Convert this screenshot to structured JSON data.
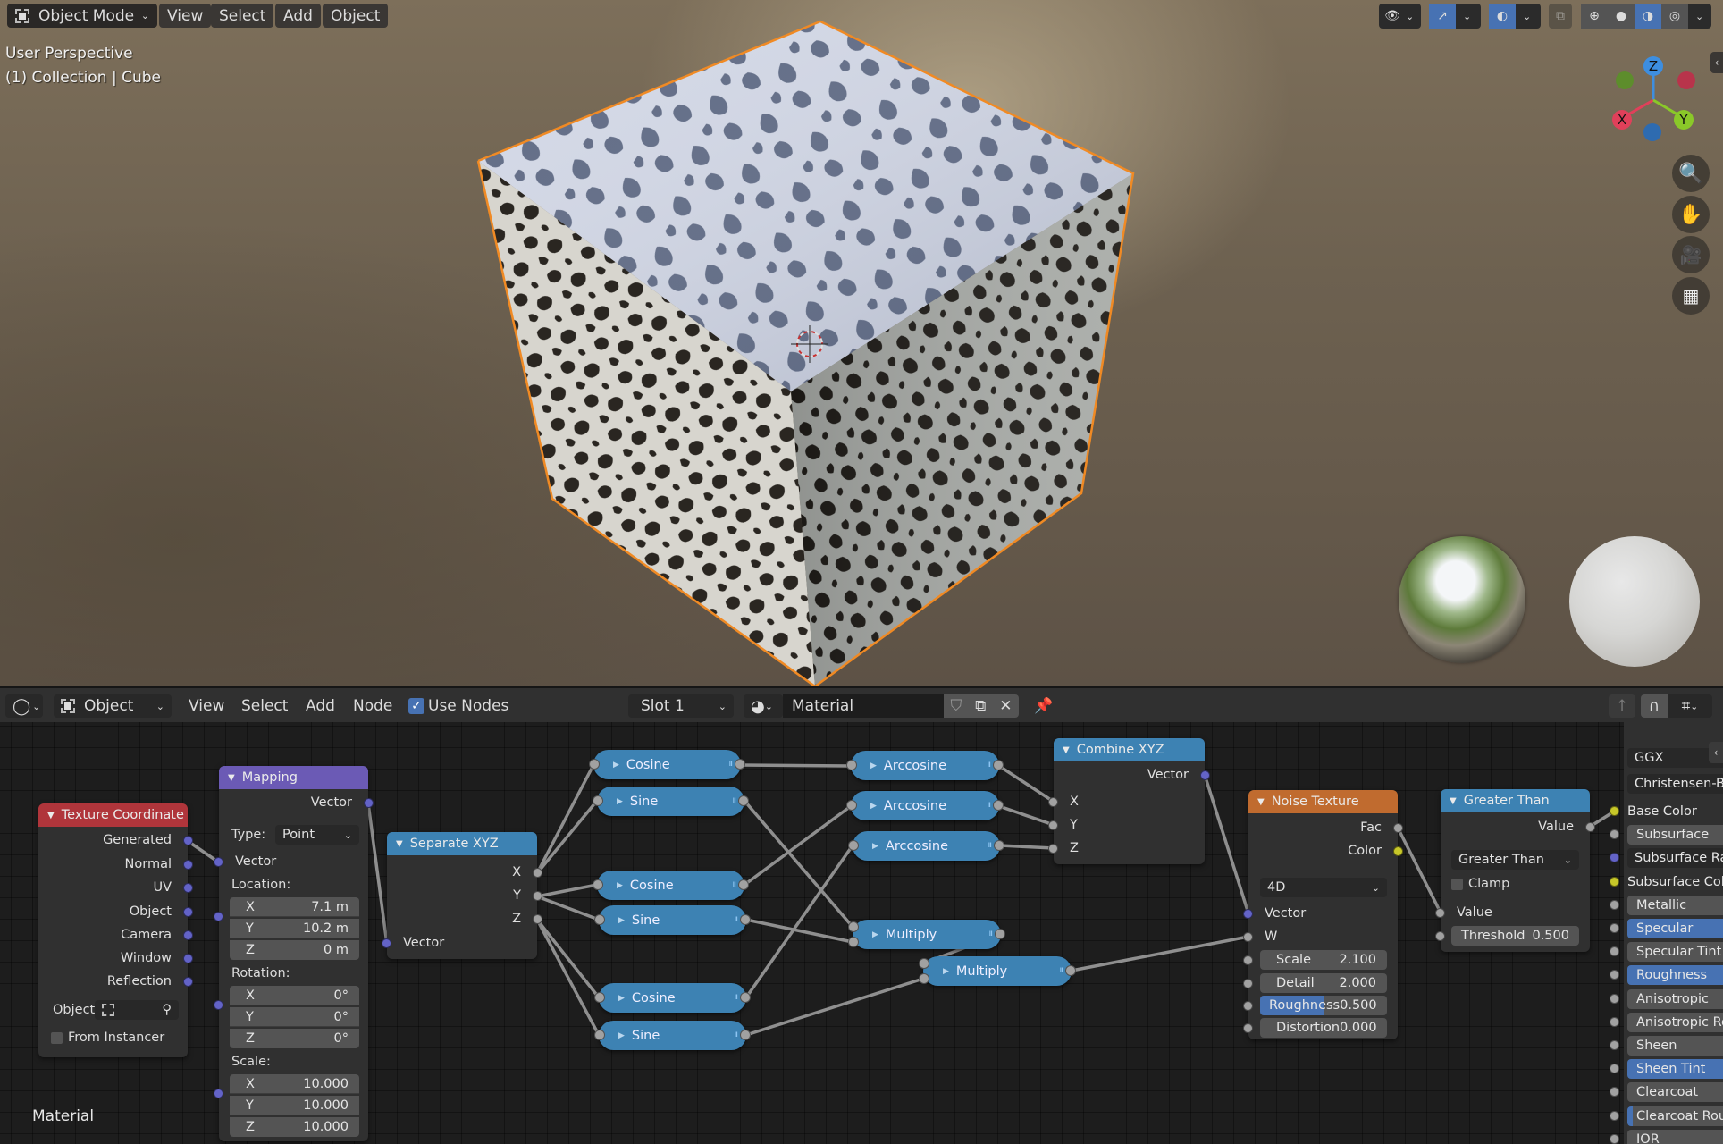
{
  "viewport": {
    "mode_label": "Object Mode",
    "menus": [
      "View",
      "Select",
      "Add",
      "Object"
    ],
    "perspective_label": "User Perspective",
    "collection_label": "(1) Collection | Cube",
    "gizmo_axes": [
      "X",
      "Y",
      "Z"
    ],
    "nav_buttons": [
      "zoom",
      "pan",
      "camera",
      "ortho-toggle"
    ],
    "shading_modes": [
      "wireframe",
      "solid",
      "material-preview",
      "rendered"
    ],
    "active_shading": "material-preview",
    "colors": {
      "selection_outline": "#f08a24",
      "active_toggle": "#4772b3"
    }
  },
  "node_editor": {
    "editor_type_icon": "shader-editor-icon",
    "object_selector": "Object",
    "menus": [
      "View",
      "Select",
      "Add",
      "Node"
    ],
    "use_nodes_label": "Use Nodes",
    "use_nodes_checked": true,
    "slot": "Slot 1",
    "material_name": "Material",
    "canvas_label": "Material",
    "nodes": {
      "texture_coordinate": {
        "title": "Texture Coordinate",
        "outputs": [
          "Generated",
          "Normal",
          "UV",
          "Object",
          "Camera",
          "Window",
          "Reflection"
        ],
        "object_label": "Object:",
        "from_instancer_label": "From Instancer",
        "from_instancer_checked": false,
        "color": "#b0353b"
      },
      "mapping": {
        "title": "Mapping",
        "output": "Vector",
        "type_label": "Type:",
        "type_value": "Point",
        "input": "Vector",
        "location_label": "Location:",
        "location": [
          {
            "axis": "X",
            "value": "7.1 m"
          },
          {
            "axis": "Y",
            "value": "10.2 m"
          },
          {
            "axis": "Z",
            "value": "0 m"
          }
        ],
        "rotation_label": "Rotation:",
        "rotation": [
          {
            "axis": "X",
            "value": "0°"
          },
          {
            "axis": "Y",
            "value": "0°"
          },
          {
            "axis": "Z",
            "value": "0°"
          }
        ],
        "scale_label": "Scale:",
        "scale": [
          {
            "axis": "X",
            "value": "10.000"
          },
          {
            "axis": "Y",
            "value": "10.000"
          },
          {
            "axis": "Z",
            "value": "10.000"
          }
        ],
        "color": "#6b5ab5"
      },
      "separate_xyz": {
        "title": "Separate XYZ",
        "outputs": [
          "X",
          "Y",
          "Z"
        ],
        "input": "Vector",
        "color": "#3d82b3"
      },
      "math_nodes": [
        {
          "label": "Cosine"
        },
        {
          "label": "Sine"
        },
        {
          "label": "Cosine"
        },
        {
          "label": "Sine"
        },
        {
          "label": "Cosine"
        },
        {
          "label": "Sine"
        },
        {
          "label": "Arccosine"
        },
        {
          "label": "Arccosine"
        },
        {
          "label": "Arccosine"
        },
        {
          "label": "Multiply"
        },
        {
          "label": "Multiply"
        }
      ],
      "combine_xyz": {
        "title": "Combine XYZ",
        "output": "Vector",
        "inputs": [
          "X",
          "Y",
          "Z"
        ]
      },
      "noise_texture": {
        "title": "Noise Texture",
        "outputs": [
          "Fac",
          "Color"
        ],
        "dimensions": "4D",
        "inputs": [
          "Vector",
          "W"
        ],
        "fields": [
          {
            "label": "Scale",
            "value": "2.100"
          },
          {
            "label": "Detail",
            "value": "2.000"
          },
          {
            "label": "Roughness",
            "value": "0.500",
            "fill": 0.5
          },
          {
            "label": "Distortion",
            "value": "0.000"
          }
        ],
        "color": "#c06b2f"
      },
      "greater_than": {
        "title": "Greater Than",
        "output": "Value",
        "operation": "Greater Than",
        "clamp_label": "Clamp",
        "clamp_checked": false,
        "input": "Value",
        "threshold_label": "Threshold",
        "threshold_value": "0.500"
      },
      "principled_bsdf": {
        "distribution": "GGX",
        "subsurface_method": "Christensen-Bu",
        "inputs": [
          {
            "label": "Base Color",
            "socket": "color",
            "style": "plain"
          },
          {
            "label": "Subsurface",
            "socket": "value",
            "style": "field"
          },
          {
            "label": "Subsurface Rad",
            "socket": "vector",
            "style": "dropdown"
          },
          {
            "label": "Subsurface Colo",
            "socket": "color",
            "style": "plain"
          },
          {
            "label": "Metallic",
            "socket": "value",
            "style": "field"
          },
          {
            "label": "Specular",
            "socket": "value",
            "style": "blue"
          },
          {
            "label": "Specular Tint",
            "socket": "value",
            "style": "field"
          },
          {
            "label": "Roughness",
            "socket": "value",
            "style": "blue"
          },
          {
            "label": "Anisotropic",
            "socket": "value",
            "style": "field"
          },
          {
            "label": "Anisotropic Rot",
            "socket": "value",
            "style": "field"
          },
          {
            "label": "Sheen",
            "socket": "value",
            "style": "field"
          },
          {
            "label": "Sheen Tint",
            "socket": "value",
            "style": "blue"
          },
          {
            "label": "Clearcoat",
            "socket": "value",
            "style": "field"
          },
          {
            "label": "Clearcoat Roug",
            "socket": "value",
            "style": "partial"
          },
          {
            "label": "IOR",
            "socket": "value",
            "style": "field"
          }
        ]
      }
    }
  }
}
